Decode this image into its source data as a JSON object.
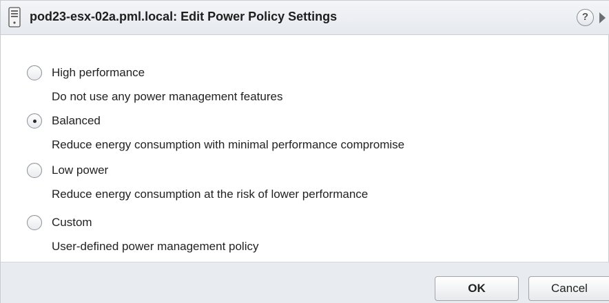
{
  "dialog": {
    "title": "pod23-esx-02a.pml.local: Edit Power Policy Settings",
    "help_label": "?"
  },
  "options": [
    {
      "label": "High performance",
      "description": "Do not use any power management features",
      "selected": false
    },
    {
      "label": "Balanced",
      "description": "Reduce energy consumption with minimal performance compromise",
      "selected": true
    },
    {
      "label": "Low power",
      "description": "Reduce energy consumption at the risk of lower performance",
      "selected": false
    },
    {
      "label": "Custom",
      "description": "User-defined power management policy",
      "selected": false
    }
  ],
  "footer": {
    "ok_label": "OK",
    "cancel_label": "Cancel"
  },
  "icons": {
    "title": "server-icon",
    "help": "help-icon",
    "more": "chevron-right-icon"
  }
}
